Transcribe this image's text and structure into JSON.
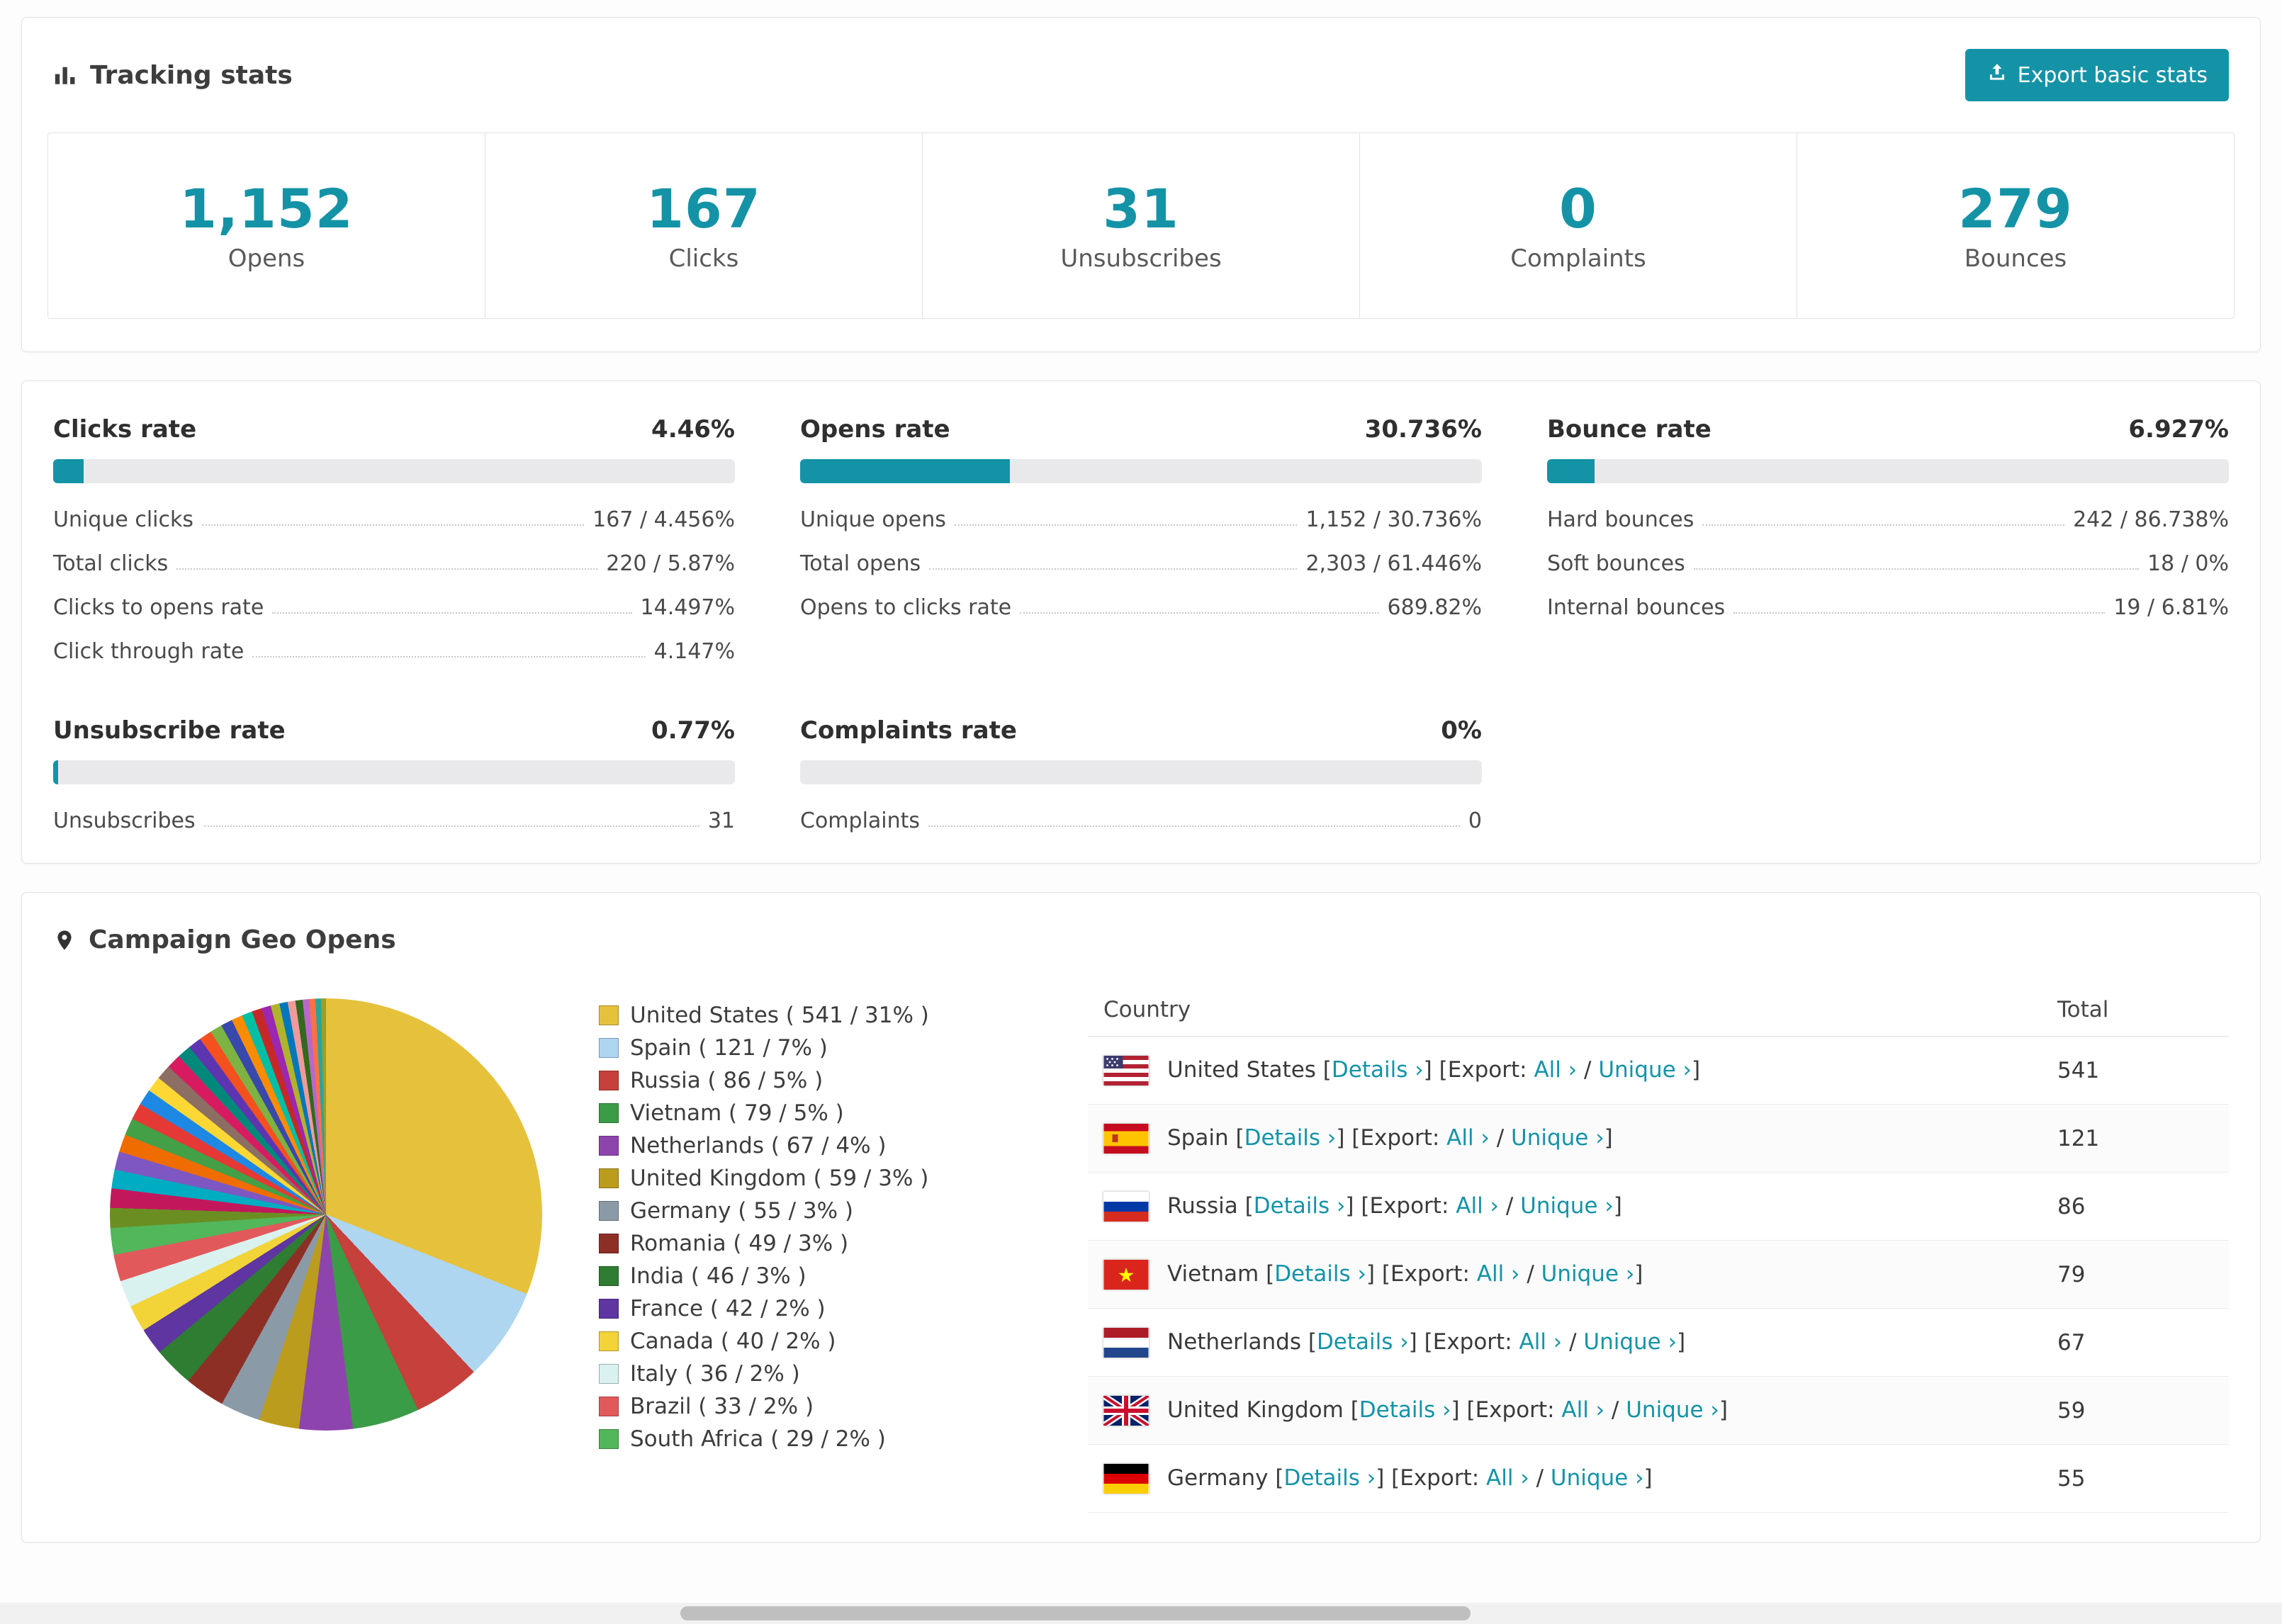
{
  "accent_color": "#1493a7",
  "header": {
    "title": "Tracking stats",
    "export_button": "Export basic stats"
  },
  "summary": [
    {
      "value": "1,152",
      "label": "Opens"
    },
    {
      "value": "167",
      "label": "Clicks"
    },
    {
      "value": "31",
      "label": "Unsubscribes"
    },
    {
      "value": "0",
      "label": "Complaints"
    },
    {
      "value": "279",
      "label": "Bounces"
    }
  ],
  "rates": [
    {
      "title": "Clicks rate",
      "value_label": "4.46%",
      "percent": 4.46,
      "rows": [
        {
          "label": "Unique clicks",
          "value": "167 / 4.456%"
        },
        {
          "label": "Total clicks",
          "value": "220 / 5.87%"
        },
        {
          "label": "Clicks to opens rate",
          "value": "14.497%"
        },
        {
          "label": "Click through rate",
          "value": "4.147%"
        }
      ]
    },
    {
      "title": "Opens rate",
      "value_label": "30.736%",
      "percent": 30.736,
      "rows": [
        {
          "label": "Unique opens",
          "value": "1,152 / 30.736%"
        },
        {
          "label": "Total opens",
          "value": "2,303 / 61.446%"
        },
        {
          "label": "Opens to clicks rate",
          "value": "689.82%"
        }
      ]
    },
    {
      "title": "Bounce rate",
      "value_label": "6.927%",
      "percent": 6.927,
      "rows": [
        {
          "label": "Hard bounces",
          "value": "242 / 86.738%"
        },
        {
          "label": "Soft bounces",
          "value": "18 / 0%"
        },
        {
          "label": "Internal bounces",
          "value": "19 / 6.81%"
        }
      ]
    },
    {
      "title": "Unsubscribe rate",
      "value_label": "0.77%",
      "percent": 0.77,
      "rows": [
        {
          "label": "Unsubscribes",
          "value": "31"
        }
      ]
    },
    {
      "title": "Complaints rate",
      "value_label": "0%",
      "percent": 0,
      "rows": [
        {
          "label": "Complaints",
          "value": "0"
        }
      ]
    }
  ],
  "geo": {
    "title": "Campaign Geo Opens",
    "table": {
      "country_header": "Country",
      "total_header": "Total",
      "links": {
        "open": "[",
        "close": "]",
        "details": "Details ›",
        "export_prefix": "[Export:",
        "all": "All ›",
        "unique": "Unique ›",
        "slash": "/"
      },
      "rows": [
        {
          "flag": "us",
          "country": "United States",
          "total": "541"
        },
        {
          "flag": "es",
          "country": "Spain",
          "total": "121"
        },
        {
          "flag": "ru",
          "country": "Russia",
          "total": "86"
        },
        {
          "flag": "vn",
          "country": "Vietnam",
          "total": "79"
        },
        {
          "flag": "nl",
          "country": "Netherlands",
          "total": "67"
        },
        {
          "flag": "gb",
          "country": "United Kingdom",
          "total": "59"
        },
        {
          "flag": "de",
          "country": "Germany",
          "total": "55"
        }
      ]
    }
  },
  "chart_data": {
    "type": "pie",
    "title": "Campaign Geo Opens",
    "legend_position": "right",
    "slices": [
      {
        "label": "United States",
        "value": 541,
        "percent": 31,
        "color": "#e6c13c"
      },
      {
        "label": "Spain",
        "value": 121,
        "percent": 7,
        "color": "#aed6f1"
      },
      {
        "label": "Russia",
        "value": 86,
        "percent": 5,
        "color": "#c6403c"
      },
      {
        "label": "Vietnam",
        "value": 79,
        "percent": 5,
        "color": "#3a9c46"
      },
      {
        "label": "Netherlands",
        "value": 67,
        "percent": 4,
        "color": "#8e44ad"
      },
      {
        "label": "United Kingdom",
        "value": 59,
        "percent": 3,
        "color": "#bb9c1c"
      },
      {
        "label": "Germany",
        "value": 55,
        "percent": 3,
        "color": "#8a9aa6"
      },
      {
        "label": "Romania",
        "value": 49,
        "percent": 3,
        "color": "#8e2f26"
      },
      {
        "label": "India",
        "value": 46,
        "percent": 3,
        "color": "#2e7d32"
      },
      {
        "label": "France",
        "value": 42,
        "percent": 2,
        "color": "#5e35a1"
      },
      {
        "label": "Canada",
        "value": 40,
        "percent": 2,
        "color": "#f2d338"
      },
      {
        "label": "Italy",
        "value": 36,
        "percent": 2,
        "color": "#d9f2ef"
      },
      {
        "label": "Brazil",
        "value": 33,
        "percent": 2,
        "color": "#e2595c"
      },
      {
        "label": "South Africa",
        "value": 29,
        "percent": 2,
        "color": "#52b65a"
      }
    ],
    "other_percent": 26,
    "other_colors": [
      "#6b8e23",
      "#c2185b",
      "#00acc1",
      "#7e57c2",
      "#ef6c00",
      "#43a047",
      "#e53935",
      "#1e88e5",
      "#fdd835",
      "#8d6e63",
      "#d81b60",
      "#00897b",
      "#5e35b1",
      "#f4511e",
      "#7cb342",
      "#3949ab",
      "#fb8c00",
      "#00bfa5",
      "#c62828",
      "#9c27b0",
      "#afb42b",
      "#0277bd",
      "#ef9a9a",
      "#33691e",
      "#ba68c8",
      "#ff7043",
      "#26a69a",
      "#9e9d24"
    ]
  }
}
